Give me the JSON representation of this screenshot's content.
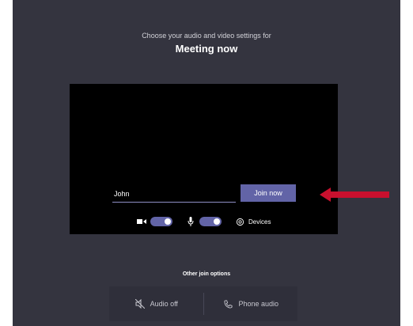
{
  "header": {
    "subtitle": "Choose your audio and video settings for",
    "title": "Meeting now"
  },
  "preview": {
    "name_value": "John",
    "join_label": "Join now",
    "camera_on": true,
    "mic_on": true,
    "devices_label": "Devices"
  },
  "annotation": {
    "arrow_color": "#c8102e"
  },
  "other_options": {
    "label": "Other join options",
    "audio_off_label": "Audio off",
    "phone_audio_label": "Phone audio"
  },
  "colors": {
    "accent": "#6264a7",
    "background": "#34343f",
    "preview_background": "#000000"
  }
}
